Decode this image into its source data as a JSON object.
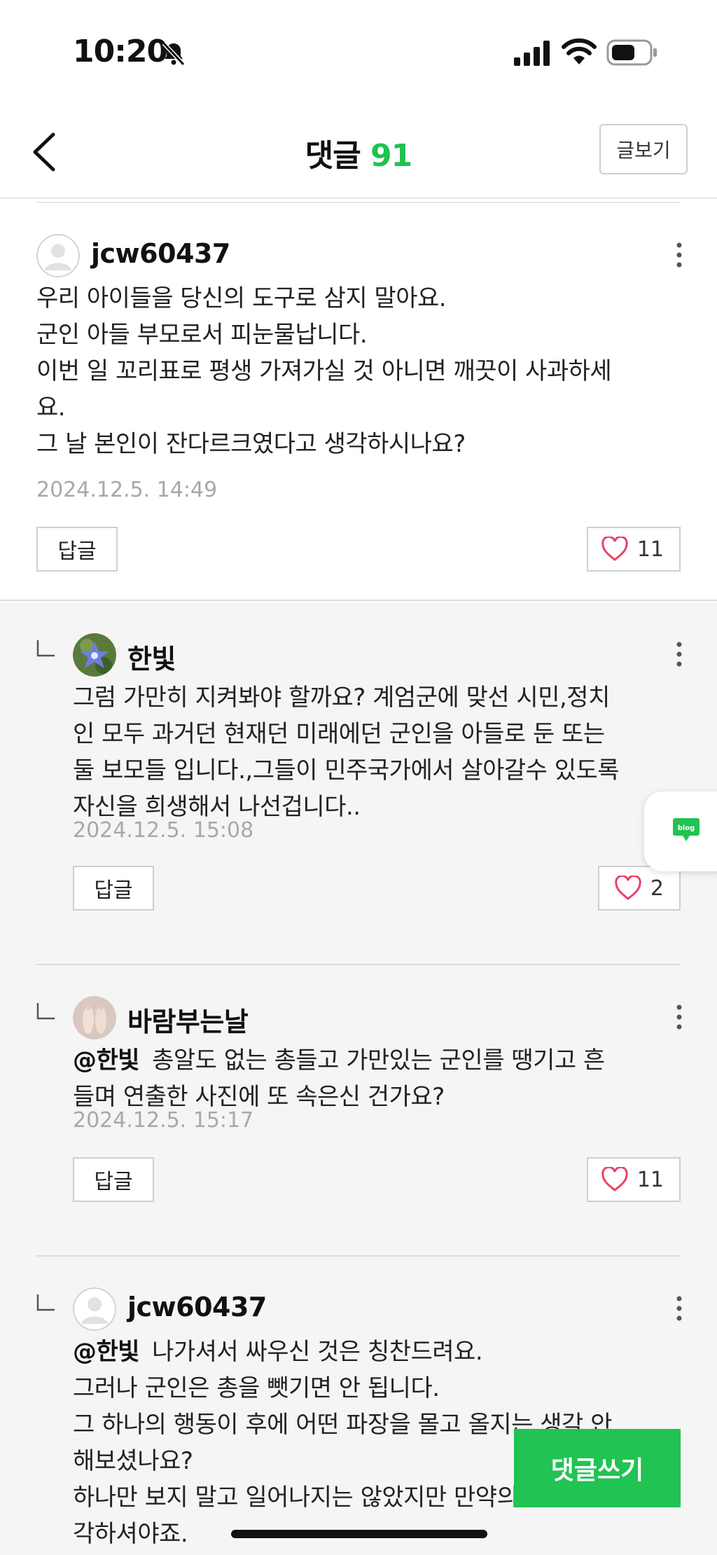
{
  "status_bar": {
    "time": "10:20"
  },
  "header": {
    "title": "댓글",
    "count": "91",
    "view_post_label": "글보기"
  },
  "comments": [
    {
      "username": "jcw60437",
      "text": "우리 아이들을 당신의 도구로 삼지 말아요.\n군인 아들 부모로서 피눈물납니다.\n이번 일 꼬리표로 평생 가져가실 것 아니면 깨끗이 사과하세\n요.\n그 날 본인이 잔다르크였다고 생각하시나요?",
      "timestamp": "2024.12.5. 14:49",
      "reply_label": "답글",
      "likes": "11"
    },
    {
      "username": "한빛",
      "text": "그럼 가만히 지켜봐야 할까요? 계엄군에 맞선 시민,정치\n인 모두 과거던 현재던 미래에던 군인을 아들로 둔 또는\n둘 보모들 입니다.,그들이 민주국가에서 살아갈수 있도록\n자신을 희생해서 나선겁니다..",
      "timestamp": "2024.12.5. 15:08",
      "reply_label": "답글",
      "likes": "2"
    },
    {
      "username": "바람부는날",
      "mention": "@한빛",
      "text": "총알도 없는 총들고 가만있는 군인를 땡기고 흔\n들며 연출한 사진에 또 속은신 건가요?",
      "timestamp": "2024.12.5. 15:17",
      "reply_label": "답글",
      "likes": "11"
    },
    {
      "username": "jcw60437",
      "mention": "@한빛",
      "text": "나가셔서 싸우신 것은 칭찬드려요.\n그러나 군인은 총을 뺏기면 안 됩니다.\n그 하나의 행동이 후에 어떤 파장을 몰고 올지는 생각 안\n해보셨나요?\n하나만 보지 말고 일어나지는 않았지만 만약의 사태를 생\n각하셔야죠."
    }
  ],
  "blog_badge": "blog",
  "write_comment_label": "댓글쓰기",
  "colors": {
    "accent": "#21c352",
    "heart": "#ee3f6b",
    "reply_bg": "#f5f5f5"
  }
}
